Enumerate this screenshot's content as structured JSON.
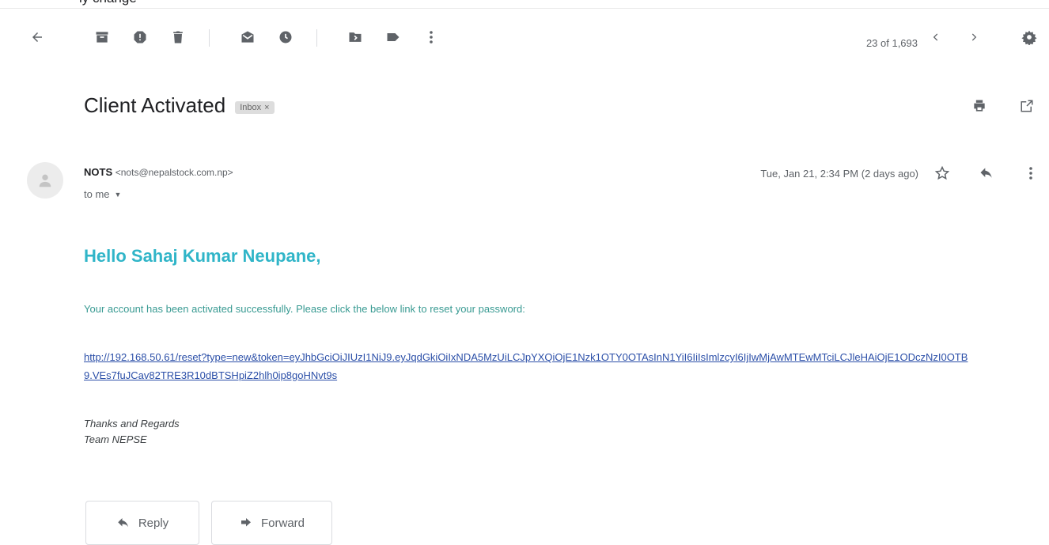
{
  "fragment": "ly cnange",
  "toolbar": {
    "icons": [
      "back-icon",
      "archive-icon",
      "report-spam-icon",
      "delete-icon",
      "mark-unread-icon",
      "snooze-icon",
      "move-to-icon",
      "labels-icon",
      "more-icon"
    ],
    "count": "23 of 1,693"
  },
  "email": {
    "subject": "Client Activated",
    "label": "Inbox",
    "label_close": "×",
    "sender_name": "NOTS",
    "sender_email": "<nots@nepalstock.com.np>",
    "recipient": "to me",
    "date": "Tue, Jan 21, 2:34 PM (2 days ago)",
    "greeting": "Hello Sahaj Kumar Neupane,",
    "body": "Your account has been activated successfully. Please click the below link to reset your password:",
    "link": "http://192.168.50.61/reset?type=new&token=eyJhbGciOiJIUzI1NiJ9.eyJqdGkiOiIxNDA5MzUiLCJpYXQiOjE1Nzk1OTY0OTAsInN1YiI6IiIsImlzcyI6IjIwMjAwMTEwMTciLCJleHAiOjE1ODczNzI0OTB9.VEs7fuJCav82TRE3R10dBTSHpiZ2hlh0ip8goHNvt9s",
    "signature_line1": "Thanks and Regards",
    "signature_line2": "Team NEPSE"
  },
  "actions": {
    "reply_label": "Reply",
    "forward_label": "Forward"
  },
  "colors": {
    "greeting": "#30b5c8",
    "body_text": "#389a92",
    "link": "#2b4fa8"
  }
}
